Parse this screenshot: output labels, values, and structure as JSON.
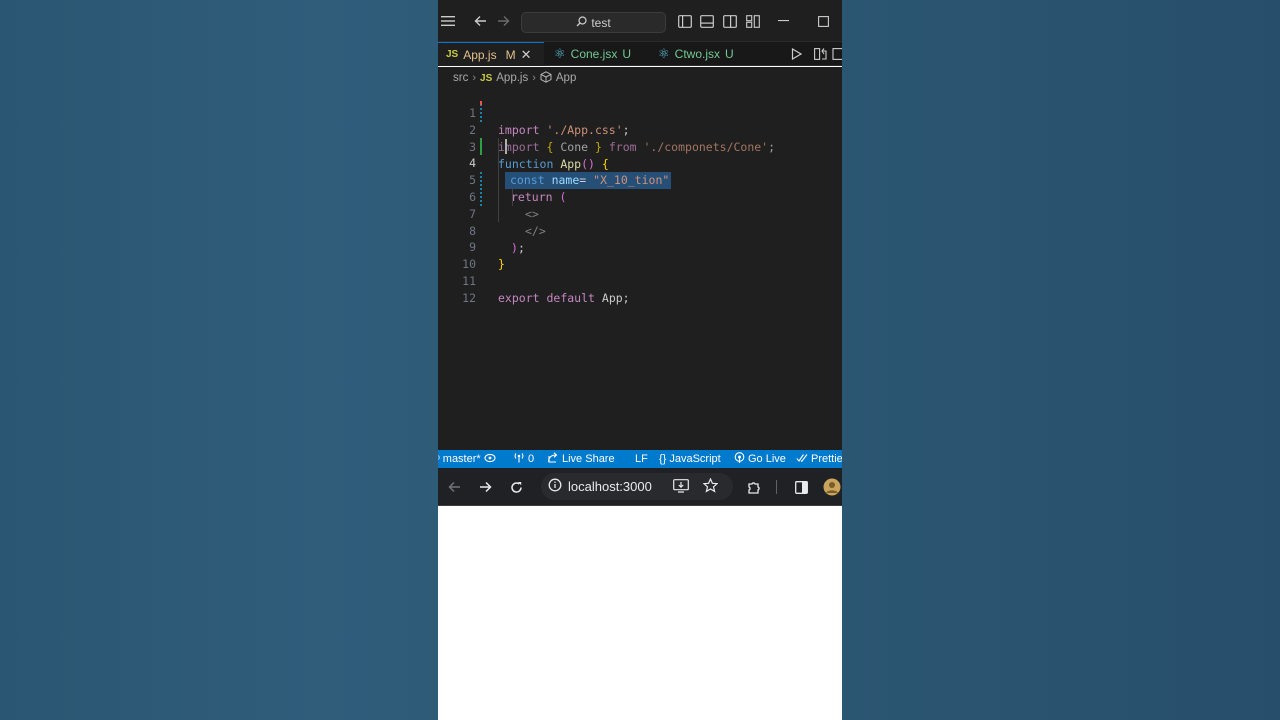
{
  "titlebar": {
    "search_text": "test"
  },
  "tabs": [
    {
      "icon": "JS",
      "label": "App.js",
      "status": "M",
      "active": true
    },
    {
      "icon": "react",
      "label": "Cone.jsx",
      "status": "U",
      "active": false
    },
    {
      "icon": "react",
      "label": "Ctwo.jsx",
      "status": "U",
      "active": false
    }
  ],
  "breadcrumb": {
    "folder": "src",
    "file_icon": "JS",
    "file": "App.js",
    "symbol": "App"
  },
  "editor": {
    "line_numbers": [
      "1",
      "2",
      "3",
      "4",
      "5",
      "6",
      "7",
      "8",
      "9",
      "10",
      "11",
      "12"
    ],
    "current_line": "4",
    "lines": {
      "l1": {
        "kw": "import",
        "str": "'./App.css'",
        "end": ";"
      },
      "l2": {
        "kw": "import",
        "open": "{",
        "name": " Cone ",
        "close": "}",
        "from": "from",
        "str": "'./componets/Cone'",
        "end": ";"
      },
      "l3": {
        "kw": "function",
        "fn": "App",
        "paren": "()",
        "brace": "{"
      },
      "l4": {
        "kw": "const",
        "var": "name",
        "eq": "=",
        "str": "\"X_10_tion\""
      },
      "l5": {
        "kw": "return",
        "paren": "("
      },
      "l6": {
        "tag": "<>"
      },
      "l7": {
        "tag": "</>"
      },
      "l8": {
        "paren": ")",
        "end": ";"
      },
      "l9": {
        "brace": "}"
      },
      "l11": {
        "kw1": "export",
        "kw2": "default",
        "name": "App",
        "end": ";"
      }
    }
  },
  "statusbar": {
    "branch": "master*",
    "ports": "0",
    "live_share": "Live Share",
    "eol": "LF",
    "language": "JavaScript",
    "language_prefix": "{}",
    "go_live": "Go Live",
    "prettier": "Prettier"
  },
  "browser": {
    "url": "localhost:3000"
  },
  "colors": {
    "accent": "#007acc",
    "editor_bg": "#1f1f1f",
    "selection": "#264f78"
  }
}
